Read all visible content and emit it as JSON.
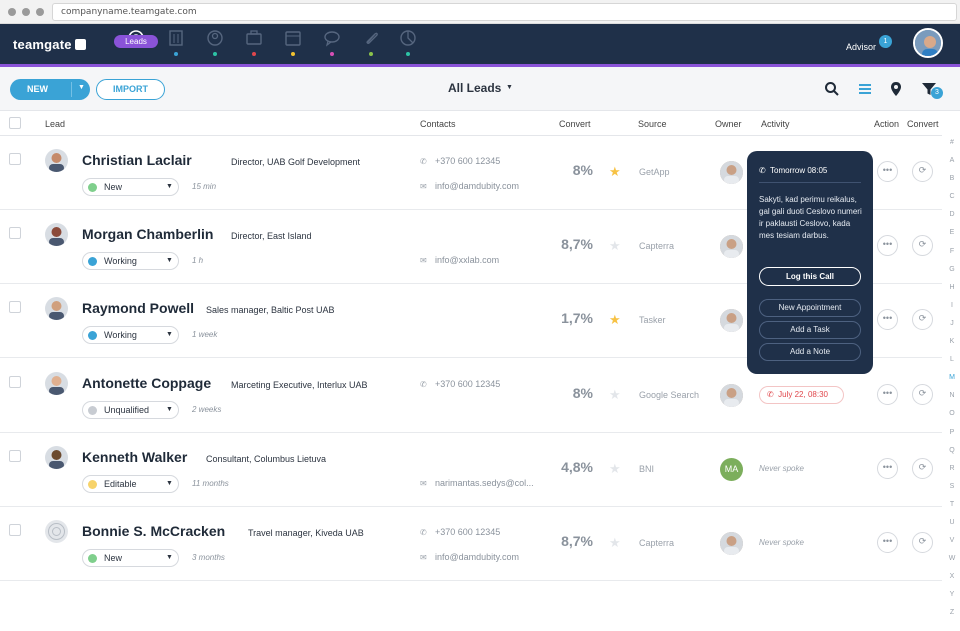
{
  "browser": {
    "url": "companyname.teamgate.com"
  },
  "app": {
    "logo": "teamgate",
    "active_section": "Leads",
    "user_label": "Advisor",
    "notification_count": "1"
  },
  "nav": {
    "items": [
      {
        "icon": "target-icon",
        "dot": "#ffffff"
      },
      {
        "icon": "building-icon",
        "dot": "#3aa3d6"
      },
      {
        "icon": "people-icon",
        "dot": "#2dc3a5"
      },
      {
        "icon": "briefcase-icon",
        "dot": "#e0474c"
      },
      {
        "icon": "calendar-icon",
        "dot": "#f2c230"
      },
      {
        "icon": "chat-icon",
        "dot": "#d64fb5"
      },
      {
        "icon": "paperclip-icon",
        "dot": "#8bc34a"
      },
      {
        "icon": "chart-icon",
        "dot": "#2dc3a5"
      }
    ]
  },
  "toolbar": {
    "new_label": "NEW",
    "import_label": "IMPORT",
    "view_title": "All Leads",
    "filter_count": "3"
  },
  "table": {
    "headers": {
      "lead": "Lead",
      "contacts": "Contacts",
      "convert": "Convert",
      "source": "Source",
      "owner": "Owner",
      "activity": "Activity",
      "action": "Action",
      "convert_action": "Convert"
    },
    "rows": [
      {
        "name": "Christian Laclair",
        "title": "Director, UAB Golf Development",
        "status": "New",
        "status_color": "#7fcf8c",
        "time": "15 min",
        "phone": "+370 600 12345",
        "email": "info@damdubity.com",
        "convert": "8%",
        "starred": true,
        "source": "GetApp",
        "owner": "photo",
        "activity": ""
      },
      {
        "name": "Morgan Chamberlin",
        "title": "Director, East Island",
        "status": "Working",
        "status_color": "#3aa3d6",
        "time": "1 h",
        "phone": "",
        "email": "info@xxlab.com",
        "convert": "8,7%",
        "starred": false,
        "source": "Capterra",
        "owner": "photo",
        "activity": ""
      },
      {
        "name": "Raymond Powell",
        "title": "Sales manager, Baltic Post UAB",
        "status": "Working",
        "status_color": "#3aa3d6",
        "time": "1 week",
        "phone": "",
        "email": "",
        "convert": "1,7%",
        "starred": true,
        "source": "Tasker",
        "owner": "photo",
        "activity": ""
      },
      {
        "name": "Antonette Coppage",
        "title": "Marceting Executive, Interlux UAB",
        "status": "Unqualified",
        "status_color": "#c8ccd2",
        "time": "2 weeks",
        "phone": "+370 600 12345",
        "email": "",
        "convert": "8%",
        "starred": false,
        "source": "Google Search",
        "owner": "photo",
        "activity": "July 22, 08:30"
      },
      {
        "name": "Kenneth Walker",
        "title": "Consultant, Columbus Lietuva",
        "status": "Editable",
        "status_color": "#f7d36a",
        "time": "11 months",
        "phone": "",
        "email": "narimantas.sedys@col...",
        "convert": "4,8%",
        "starred": false,
        "source": "BNI",
        "owner": "MA",
        "activity": "Never spoke"
      },
      {
        "name": "Bonnie S. McCracken",
        "title": "Travel manager, Kiveda UAB",
        "status": "New",
        "status_color": "#7fcf8c",
        "time": "3 months",
        "phone": "+370 600 12345",
        "email": "info@damdubity.com",
        "convert": "8,7%",
        "starred": false,
        "source": "Capterra",
        "owner": "photo",
        "activity": "Never spoke"
      }
    ]
  },
  "popover": {
    "header": "Tomorrow  08:05",
    "body": "Sakyti, kad perimu reikalus, gal gali duoti Ceslovo numeri ir paklausti Ceslovo, kada mes tesiam darbus.",
    "primary": "Log this Call",
    "actions": [
      "New Appointment",
      "Add a Task",
      "Add a Note"
    ]
  },
  "alphabet": [
    "#",
    "A",
    "B",
    "C",
    "D",
    "E",
    "F",
    "G",
    "H",
    "I",
    "J",
    "K",
    "L",
    "M",
    "N",
    "O",
    "P",
    "Q",
    "R",
    "S",
    "T",
    "U",
    "V",
    "W",
    "X",
    "Y",
    "Z"
  ],
  "alphabet_active": "M",
  "colors": {
    "nav_bg": "#1f3049",
    "accent": "#3aa3d6",
    "purple": "#8a53d8",
    "star": "#f7c244"
  }
}
